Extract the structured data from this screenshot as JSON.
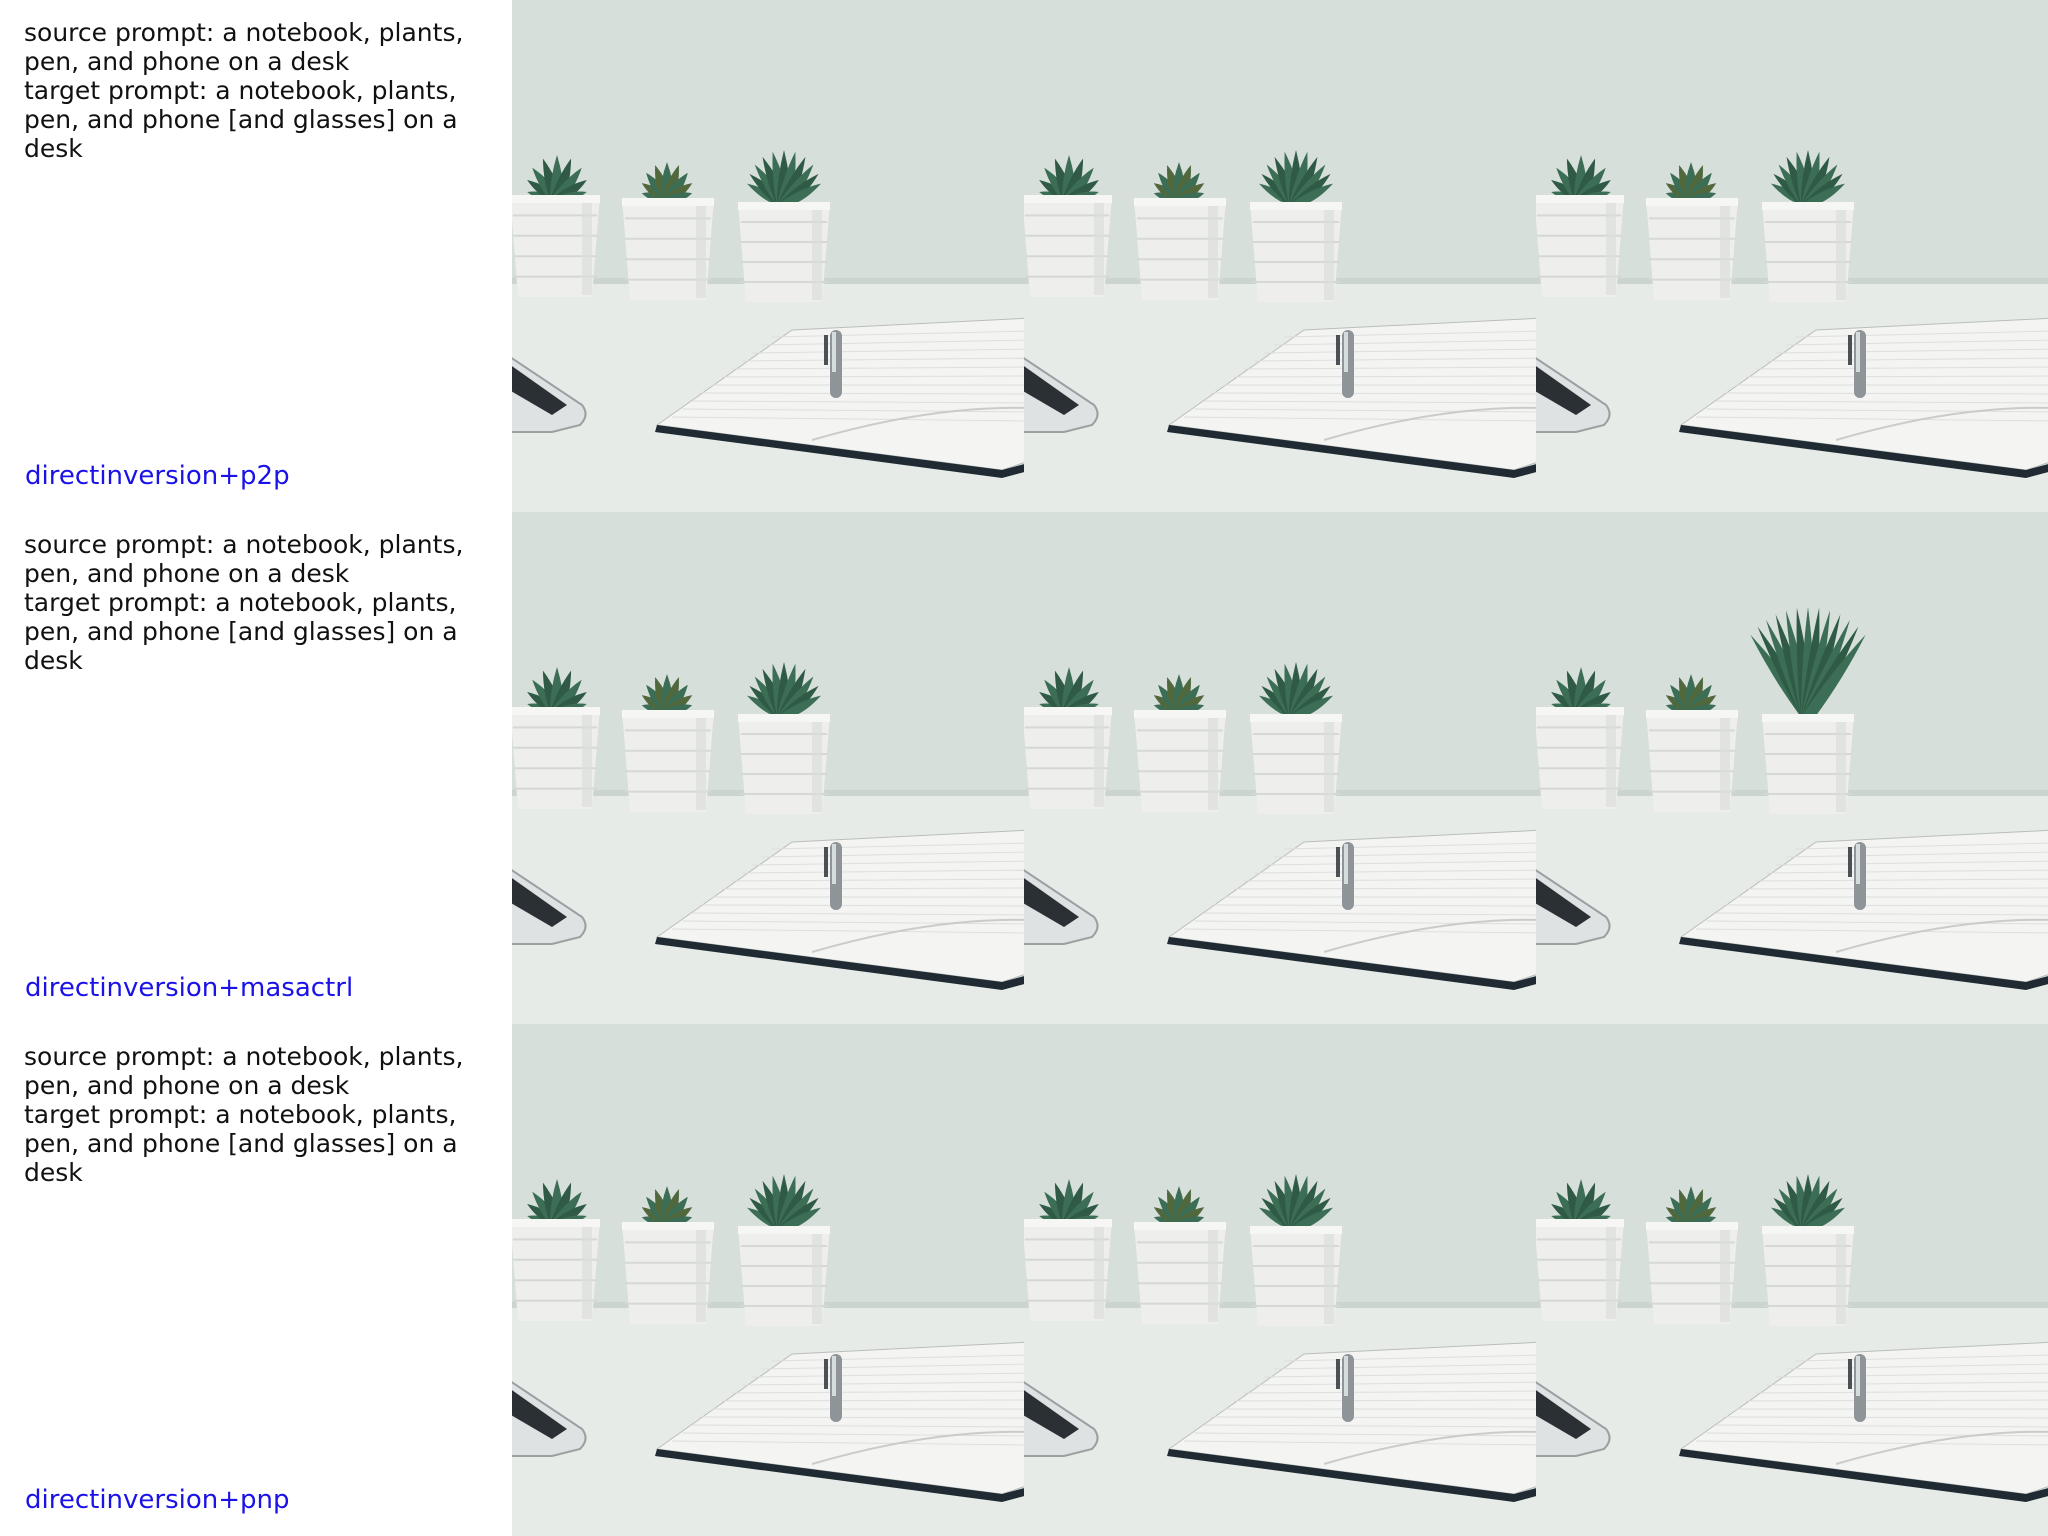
{
  "rows": [
    {
      "source_prompt": "source prompt: a notebook, plants, pen, and phone on a desk",
      "target_prompt": "target prompt: a notebook, plants, pen, and phone [and glasses] on a desk",
      "method": "directinversion+p2p",
      "images": [
        {
          "name": "source-image",
          "tall_right_plant": false
        },
        {
          "name": "reconstruction-image",
          "tall_right_plant": false
        },
        {
          "name": "edited-image",
          "tall_right_plant": false
        }
      ]
    },
    {
      "source_prompt": "source prompt: a notebook, plants, pen, and phone on a desk",
      "target_prompt": "target prompt: a notebook, plants, pen, and phone [and glasses] on a desk",
      "method": "directinversion+masactrl",
      "images": [
        {
          "name": "source-image",
          "tall_right_plant": false
        },
        {
          "name": "reconstruction-image",
          "tall_right_plant": false
        },
        {
          "name": "edited-image",
          "tall_right_plant": true
        }
      ]
    },
    {
      "source_prompt": "source prompt: a notebook, plants, pen, and phone on a desk",
      "target_prompt": "target prompt: a notebook, plants, pen, and phone [and glasses] on a desk",
      "method": "directinversion+pnp",
      "images": [
        {
          "name": "source-image",
          "tall_right_plant": false
        },
        {
          "name": "reconstruction-image",
          "tall_right_plant": false
        },
        {
          "name": "edited-image",
          "tall_right_plant": false
        }
      ]
    }
  ],
  "colors": {
    "wall": "#d7dfdb",
    "desk": "#e6ebe8",
    "pot": "#eeeeec",
    "leaf": "#2f5a45",
    "notebook_edge": "#1f2a33",
    "method_label": "#1a12e6"
  }
}
